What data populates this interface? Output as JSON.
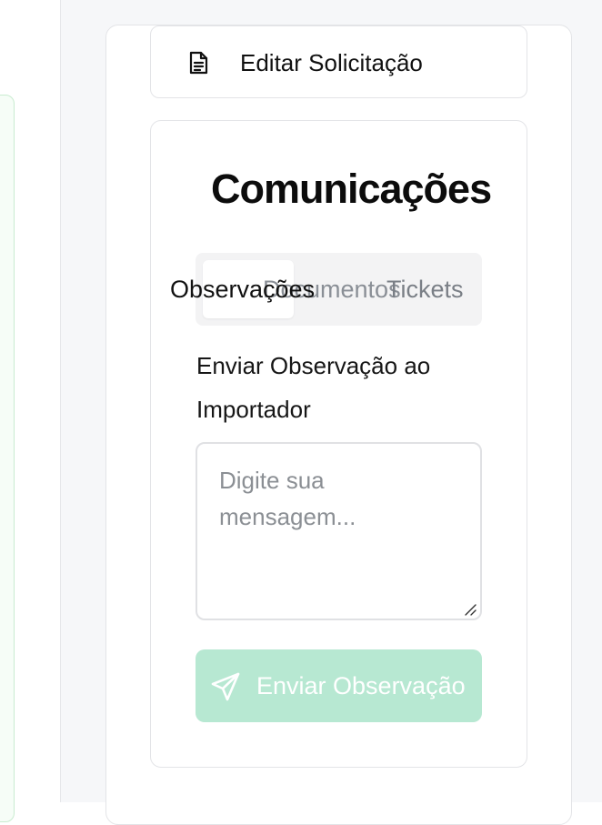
{
  "edit_request": {
    "label": "Editar Solicitação",
    "icon": "document-icon"
  },
  "communications": {
    "title": "Comunicações",
    "tabs": [
      {
        "label": "Observações",
        "active": true
      },
      {
        "label": "Documentos",
        "active": false
      },
      {
        "label": "Tickets",
        "active": false
      }
    ],
    "send_label": "Enviar Observação ao Importador",
    "message": {
      "value": "",
      "placeholder": "Digite sua mensagem..."
    },
    "send_button": {
      "label": "Enviar Observação",
      "icon": "send-icon",
      "color": "#b7e8d2"
    }
  }
}
